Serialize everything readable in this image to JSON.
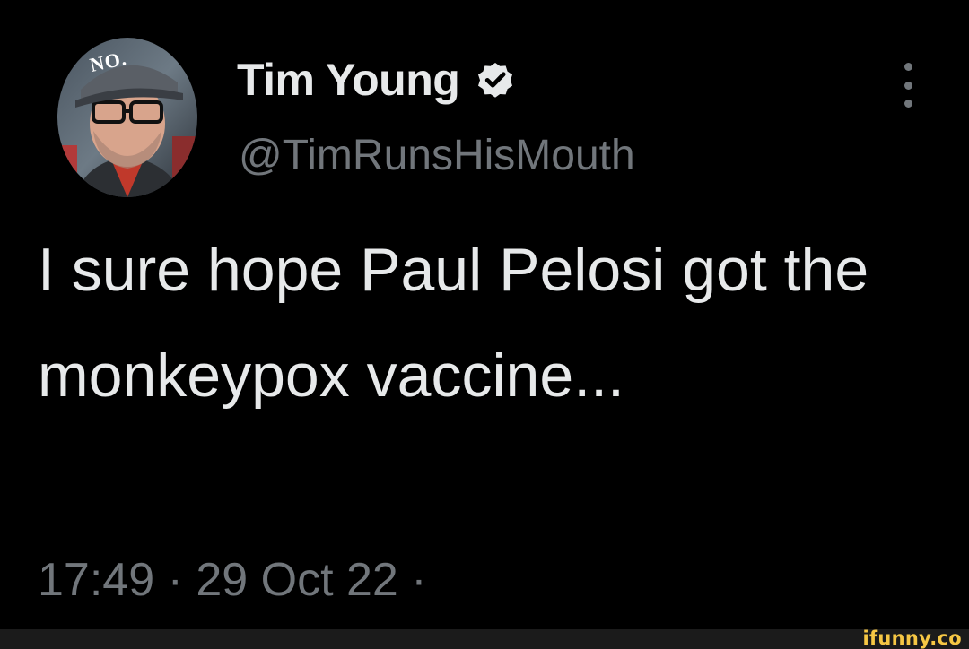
{
  "tweet": {
    "display_name": "Tim Young",
    "handle": "@TimRunsHisMouth",
    "text": "I sure hope Paul Pelosi got the monkeypox vaccine...",
    "time": "17:49",
    "separator": "·",
    "date": "29 Oct 22",
    "trailing_separator": "·",
    "verified": true,
    "verified_icon": "verified-badge-icon",
    "more_icon": "more-vertical-icon"
  },
  "hat_text": "NO.",
  "watermark": {
    "brand": "ifunny.co"
  },
  "colors": {
    "background": "#000000",
    "primary_text": "#e7e9ea",
    "secondary_text": "#71767b",
    "watermark": "#f6c744"
  }
}
